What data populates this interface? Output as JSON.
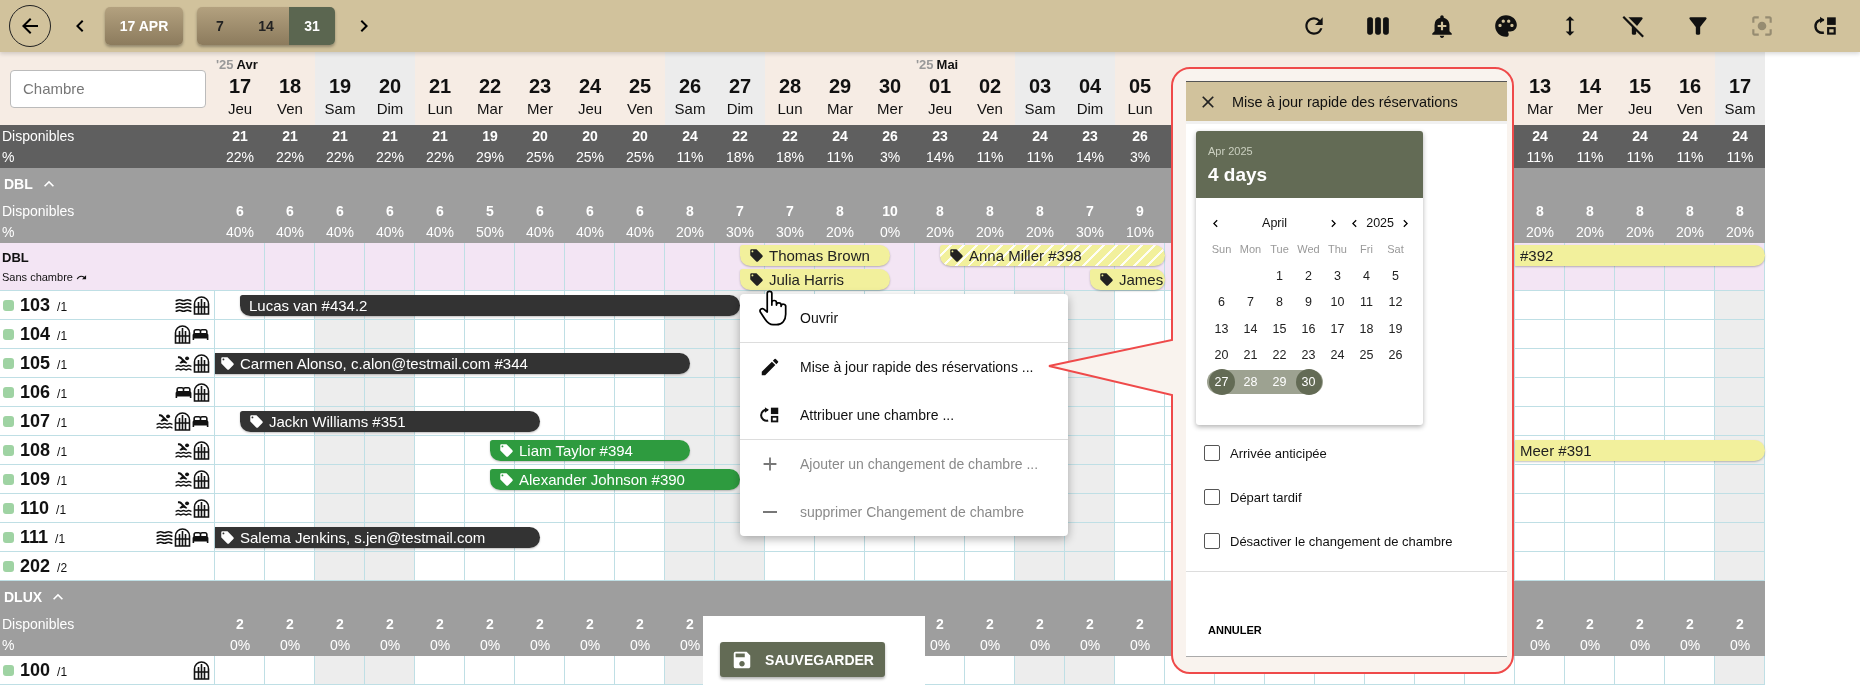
{
  "toolbar": {
    "date_button": "17 APR",
    "spans": [
      {
        "label": "7",
        "selected": false
      },
      {
        "label": "14",
        "selected": false
      },
      {
        "label": "31",
        "selected": true
      }
    ],
    "actions": [
      {
        "kind": "refresh",
        "disabled": false
      },
      {
        "kind": "columns",
        "disabled": false
      },
      {
        "kind": "alert",
        "disabled": false
      },
      {
        "kind": "palette",
        "disabled": false
      },
      {
        "kind": "height",
        "disabled": false
      },
      {
        "kind": "filteroff",
        "disabled": false
      },
      {
        "kind": "filter",
        "disabled": false
      },
      {
        "kind": "focus",
        "disabled": true
      },
      {
        "kind": "assign",
        "disabled": false
      }
    ]
  },
  "room_filter": {
    "placeholder": "Chambre"
  },
  "days": [
    {
      "day": "17",
      "weekday": "Jeu",
      "weekend": false,
      "month": {
        "year": "'25",
        "name": "Avr"
      }
    },
    {
      "day": "18",
      "weekday": "Ven",
      "weekend": false
    },
    {
      "day": "19",
      "weekday": "Sam",
      "weekend": true
    },
    {
      "day": "20",
      "weekday": "Dim",
      "weekend": true
    },
    {
      "day": "21",
      "weekday": "Lun",
      "weekend": false
    },
    {
      "day": "22",
      "weekday": "Mar",
      "weekend": false
    },
    {
      "day": "23",
      "weekday": "Mer",
      "weekend": false
    },
    {
      "day": "24",
      "weekday": "Jeu",
      "weekend": false
    },
    {
      "day": "25",
      "weekday": "Ven",
      "weekend": false
    },
    {
      "day": "26",
      "weekday": "Sam",
      "weekend": true
    },
    {
      "day": "27",
      "weekday": "Dim",
      "weekend": true
    },
    {
      "day": "28",
      "weekday": "Lun",
      "weekend": false
    },
    {
      "day": "29",
      "weekday": "Mar",
      "weekend": false
    },
    {
      "day": "30",
      "weekday": "Mer",
      "weekend": false
    },
    {
      "day": "01",
      "weekday": "Jeu",
      "weekend": false,
      "month": {
        "year": "'25",
        "name": "Mai"
      }
    },
    {
      "day": "02",
      "weekday": "Ven",
      "weekend": false
    },
    {
      "day": "03",
      "weekday": "Sam",
      "weekend": true
    },
    {
      "day": "04",
      "weekday": "Dim",
      "weekend": true
    },
    {
      "day": "05",
      "weekday": "Lun",
      "weekend": false
    },
    {
      "day": "13",
      "weekday": "Mar",
      "weekend": false
    },
    {
      "day": "14",
      "weekday": "Mer",
      "weekend": false
    },
    {
      "day": "15",
      "weekday": "Jeu",
      "weekend": false
    },
    {
      "day": "16",
      "weekday": "Ven",
      "weekend": false
    },
    {
      "day": "17",
      "weekday": "Sam",
      "weekend": true
    }
  ],
  "summary": {
    "label": "Disponibles",
    "sublabel": "%",
    "values": [
      {
        "count": "21",
        "percent": "22%"
      },
      {
        "count": "21",
        "percent": "22%"
      },
      {
        "count": "21",
        "percent": "22%"
      },
      {
        "count": "21",
        "percent": "22%"
      },
      {
        "count": "21",
        "percent": "22%"
      },
      {
        "count": "19",
        "percent": "29%"
      },
      {
        "count": "20",
        "percent": "25%"
      },
      {
        "count": "20",
        "percent": "25%"
      },
      {
        "count": "20",
        "percent": "25%"
      },
      {
        "count": "24",
        "percent": "11%"
      },
      {
        "count": "22",
        "percent": "18%"
      },
      {
        "count": "22",
        "percent": "18%"
      },
      {
        "count": "24",
        "percent": "11%"
      },
      {
        "count": "26",
        "percent": "3%"
      },
      {
        "count": "23",
        "percent": "14%"
      },
      {
        "count": "24",
        "percent": "11%"
      },
      {
        "count": "24",
        "percent": "11%"
      },
      {
        "count": "23",
        "percent": "14%"
      },
      {
        "count": "26",
        "percent": "3%"
      },
      {
        "count": "24",
        "percent": "11%"
      },
      {
        "count": "24",
        "percent": "11%"
      },
      {
        "count": "24",
        "percent": "11%"
      },
      {
        "count": "24",
        "percent": "11%"
      },
      {
        "count": "24",
        "percent": "11%"
      }
    ]
  },
  "groups": [
    {
      "name": "DBL",
      "expanded": true,
      "availability": {
        "label": "Disponibles",
        "sublabel": "%",
        "values": [
          {
            "count": "6",
            "percent": "40%"
          },
          {
            "count": "6",
            "percent": "40%"
          },
          {
            "count": "6",
            "percent": "40%"
          },
          {
            "count": "6",
            "percent": "40%"
          },
          {
            "count": "6",
            "percent": "40%"
          },
          {
            "count": "5",
            "percent": "50%"
          },
          {
            "count": "6",
            "percent": "40%"
          },
          {
            "count": "6",
            "percent": "40%"
          },
          {
            "count": "6",
            "percent": "40%"
          },
          {
            "count": "8",
            "percent": "20%"
          },
          {
            "count": "7",
            "percent": "30%"
          },
          {
            "count": "7",
            "percent": "30%"
          },
          {
            "count": "8",
            "percent": "20%"
          },
          {
            "count": "10",
            "percent": "0%"
          },
          {
            "count": "8",
            "percent": "20%"
          },
          {
            "count": "8",
            "percent": "20%"
          },
          {
            "count": "8",
            "percent": "20%"
          },
          {
            "count": "7",
            "percent": "30%"
          },
          {
            "count": "9",
            "percent": "10%"
          },
          {
            "count": "8",
            "percent": "20%"
          },
          {
            "count": "8",
            "percent": "20%"
          },
          {
            "count": "8",
            "percent": "20%"
          },
          {
            "count": "8",
            "percent": "20%"
          },
          {
            "count": "8",
            "percent": "20%"
          }
        ]
      },
      "unassigned": {
        "title": "DBL",
        "subtitle": "Sans chambre",
        "lanes": [
          [
            {
              "label": "Thomas Brown",
              "color": "#f2f09c",
              "tagged": true,
              "hatched": false,
              "continued": false
            },
            {
              "label": "Anna Miller #398",
              "color": "#f2f09c",
              "tagged": true,
              "hatched": true,
              "continued": false
            },
            {
              "label": "#392",
              "color": "#f2f09c",
              "tagged": false,
              "hatched": false,
              "continued": true
            }
          ],
          [
            {
              "label": "Julia Harris",
              "color": "#f2f09c",
              "tagged": true,
              "hatched": false,
              "continued": false
            },
            {
              "label": "James",
              "color": "#f2f09c",
              "tagged": true,
              "hatched": false,
              "continued": false
            }
          ]
        ]
      },
      "rooms": [
        {
          "number": "103",
          "capacity": "/1",
          "features": [
            {
              "kind": "waves"
            },
            {
              "kind": "arch"
            }
          ],
          "bookings": [
            {
              "label": "Lucas van #434.2",
              "color": "#333333",
              "tagged": false,
              "hatched": false,
              "continued": false
            }
          ]
        },
        {
          "number": "104",
          "capacity": "/1",
          "features": [
            {
              "kind": "arch"
            },
            {
              "kind": "bed"
            }
          ]
        },
        {
          "number": "105",
          "capacity": "/1",
          "features": [
            {
              "kind": "pool"
            },
            {
              "kind": "arch"
            }
          ],
          "bookings": [
            {
              "label": "Carmen Alonso, c.alon@testmail.com #344",
              "color": "#333333",
              "tagged": true,
              "hatched": false,
              "continued": true
            }
          ]
        },
        {
          "number": "106",
          "capacity": "/1",
          "features": [
            {
              "kind": "bed"
            },
            {
              "kind": "arch"
            }
          ]
        },
        {
          "number": "107",
          "capacity": "/1",
          "features": [
            {
              "kind": "pool"
            },
            {
              "kind": "arch"
            },
            {
              "kind": "bed"
            }
          ],
          "bookings": [
            {
              "label": "Jackn Williams #351",
              "color": "#333333",
              "tagged": true,
              "hatched": false,
              "continued": false
            }
          ]
        },
        {
          "number": "108",
          "capacity": "/1",
          "features": [
            {
              "kind": "pool"
            },
            {
              "kind": "arch"
            }
          ],
          "bookings": [
            {
              "label": "Liam Taylor #394",
              "color": "#2e9b3f",
              "tagged": true,
              "hatched": false,
              "continued": false
            },
            {
              "label": "Meer #391",
              "color": "#f2f09c",
              "tagged": false,
              "hatched": false,
              "continued": true
            }
          ]
        },
        {
          "number": "109",
          "capacity": "/1",
          "features": [
            {
              "kind": "pool"
            },
            {
              "kind": "arch"
            }
          ],
          "bookings": [
            {
              "label": "Alexander Johnson #390",
              "color": "#2e9b3f",
              "tagged": true,
              "hatched": false,
              "continued": false
            }
          ]
        },
        {
          "number": "110",
          "capacity": "/1",
          "features": [
            {
              "kind": "pool"
            },
            {
              "kind": "arch"
            }
          ]
        },
        {
          "number": "111",
          "capacity": "/1",
          "features": [
            {
              "kind": "waves"
            },
            {
              "kind": "arch"
            },
            {
              "kind": "bed"
            }
          ],
          "bookings": [
            {
              "label": "Salema Jenkins, s.jen@testmail.com",
              "color": "#333333",
              "tagged": true,
              "hatched": false,
              "continued": true
            }
          ]
        },
        {
          "number": "202",
          "capacity": "/2"
        }
      ]
    },
    {
      "name": "DLUX",
      "expanded": true,
      "availability": {
        "label": "Disponibles",
        "sublabel": "%",
        "values": [
          {
            "count": "2",
            "percent": "0%"
          },
          {
            "count": "2",
            "percent": "0%"
          },
          {
            "count": "2",
            "percent": "0%"
          },
          {
            "count": "2",
            "percent": "0%"
          },
          {
            "count": "2",
            "percent": "0%"
          },
          {
            "count": "2",
            "percent": "0%"
          },
          {
            "count": "2",
            "percent": "0%"
          },
          {
            "count": "2",
            "percent": "0%"
          },
          {
            "count": "2",
            "percent": "0%"
          },
          {
            "count": "2",
            "percent": "0%"
          },
          {
            "count": "2",
            "percent": "0%"
          },
          {
            "count": "2",
            "percent": "0%"
          },
          {
            "count": "2",
            "percent": "0%"
          },
          {
            "count": "2",
            "percent": "0%"
          },
          {
            "count": "2",
            "percent": "0%"
          },
          {
            "count": "2",
            "percent": "0%"
          },
          {
            "count": "2",
            "percent": "0%"
          },
          {
            "count": "2",
            "percent": "0%"
          },
          {
            "count": "2",
            "percent": "0%"
          },
          {
            "count": "2",
            "percent": "0%"
          }
        ]
      },
      "rooms": [
        {
          "number": "100",
          "capacity": "/1",
          "features": [
            {
              "kind": "arch"
            }
          ]
        }
      ]
    }
  ],
  "context_menu": {
    "items": [
      {
        "label": "Ouvrir",
        "kind": "open",
        "disabled": false,
        "divider_after": true
      },
      {
        "label": "Mise à jour rapide des réservations ...",
        "kind": "edit",
        "disabled": false,
        "divider_after": false
      },
      {
        "label": "Attribuer une chambre ...",
        "kind": "assign",
        "disabled": false,
        "divider_after": true
      },
      {
        "label": "Ajouter un changement de chambre ...",
        "kind": "add",
        "disabled": true,
        "divider_after": false
      },
      {
        "label": "supprimer Changement de chambre",
        "kind": "remove",
        "disabled": true,
        "divider_after": false
      }
    ]
  },
  "panel": {
    "title": "Mise à jour rapide des réservations",
    "picker": {
      "caption": "Apr 2025",
      "summary": "4 days",
      "month": "April",
      "year": "2025",
      "weekdays": [
        "Sun",
        "Mon",
        "Tue",
        "Wed",
        "Thu",
        "Fri",
        "Sat"
      ],
      "weeks": [
        [
          {
            "day": "1",
            "selected": false,
            "in_range": false
          },
          {
            "day": "2",
            "selected": false,
            "in_range": false
          },
          {
            "day": "3",
            "selected": false,
            "in_range": false
          },
          {
            "day": "4",
            "selected": false,
            "in_range": false
          },
          {
            "day": "5",
            "selected": false,
            "in_range": false
          }
        ],
        [
          {
            "day": "6",
            "selected": false,
            "in_range": false
          },
          {
            "day": "7",
            "selected": false,
            "in_range": false
          },
          {
            "day": "8",
            "selected": false,
            "in_range": false
          },
          {
            "day": "9",
            "selected": false,
            "in_range": false
          },
          {
            "day": "10",
            "selected": false,
            "in_range": false
          },
          {
            "day": "11",
            "selected": false,
            "in_range": false
          },
          {
            "day": "12",
            "selected": false,
            "in_range": false
          }
        ],
        [
          {
            "day": "13",
            "selected": false,
            "in_range": false
          },
          {
            "day": "14",
            "selected": false,
            "in_range": false
          },
          {
            "day": "15",
            "selected": false,
            "in_range": false
          },
          {
            "day": "16",
            "selected": false,
            "in_range": false
          },
          {
            "day": "17",
            "selected": false,
            "in_range": false
          },
          {
            "day": "18",
            "selected": false,
            "in_range": false
          },
          {
            "day": "19",
            "selected": false,
            "in_range": false
          }
        ],
        [
          {
            "day": "20",
            "selected": false,
            "in_range": false
          },
          {
            "day": "21",
            "selected": false,
            "in_range": false
          },
          {
            "day": "22",
            "selected": false,
            "in_range": false
          },
          {
            "day": "23",
            "selected": false,
            "in_range": false
          },
          {
            "day": "24",
            "selected": false,
            "in_range": false
          },
          {
            "day": "25",
            "selected": false,
            "in_range": false
          },
          {
            "day": "26",
            "selected": false,
            "in_range": false
          }
        ],
        [
          {
            "day": "27",
            "selected": true,
            "in_range": true
          },
          {
            "day": "28",
            "selected": false,
            "in_range": true
          },
          {
            "day": "29",
            "selected": false,
            "in_range": true
          },
          {
            "day": "30",
            "selected": true,
            "in_range": true
          }
        ]
      ]
    },
    "options": [
      {
        "label": "Arrivée anticipée",
        "checked": false
      },
      {
        "label": "Départ tardif",
        "checked": false
      },
      {
        "label": "Désactiver le changement de chambre",
        "checked": false
      }
    ],
    "cancel": "ANNULER"
  },
  "save_button": {
    "label": "SAUVEGARDER"
  }
}
